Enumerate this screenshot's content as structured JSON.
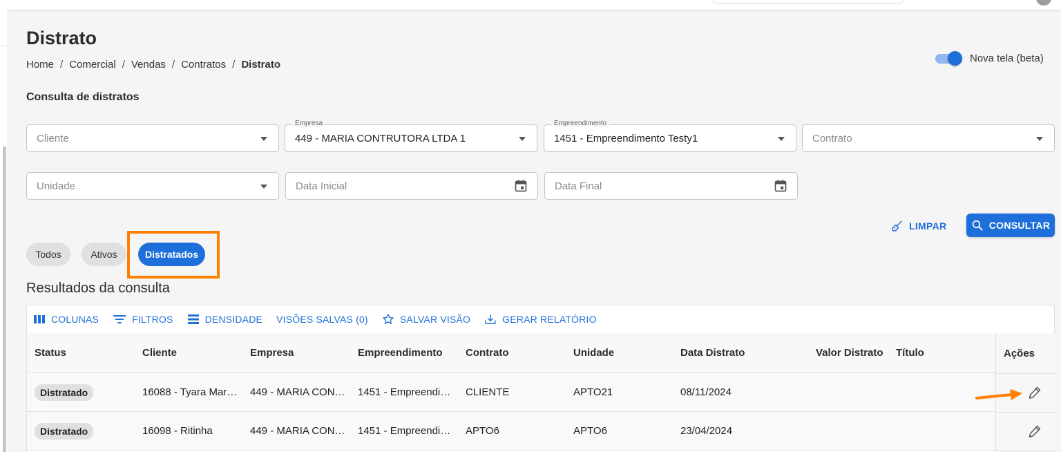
{
  "page": {
    "title": "Distrato",
    "breadcrumb": [
      "Home",
      "Comercial",
      "Vendas",
      "Contratos",
      "Distrato"
    ],
    "beta_toggle_label": "Nova tela (beta)",
    "beta_toggle_on": true,
    "section_title": "Consulta de distratos"
  },
  "filters": {
    "cliente": {
      "placeholder": "Cliente"
    },
    "empresa": {
      "label": "Empresa",
      "value": "449 - MARIA CONTRUTORA LTDA 1"
    },
    "empreendimento": {
      "label": "Empreendimento",
      "value": "1451 - Empreendimento Testy1"
    },
    "contrato": {
      "placeholder": "Contrato"
    },
    "unidade": {
      "placeholder": "Unidade"
    },
    "data_inicial": {
      "placeholder": "Data Inicial"
    },
    "data_final": {
      "placeholder": "Data Final"
    }
  },
  "actions": {
    "limpar": "LIMPAR",
    "consultar": "CONSULTAR"
  },
  "status_chips": [
    "Todos",
    "Ativos",
    "Distratados"
  ],
  "selected_chip": "Distratados",
  "results": {
    "title": "Resultados da consulta",
    "toolbar": {
      "colunas": "COLUNAS",
      "filtros": "FILTROS",
      "densidade": "DENSIDADE",
      "visoes_salvas": "VISÕES SALVAS (0)",
      "salvar_visao": "SALVAR VISÃO",
      "gerar_relatorio": "GERAR RELATÓRIO"
    },
    "columns": [
      "Status",
      "Cliente",
      "Empresa",
      "Empreendimento",
      "Contrato",
      "Unidade",
      "Data Distrato",
      "Valor Distrato",
      "Título",
      "Ações"
    ],
    "rows": [
      {
        "status": "Distratado",
        "cliente": "16088 - Tyara Mar…",
        "empresa": "449 - MARIA CON…",
        "empreendimento": "1451 - Empreendi…",
        "contrato": "CLIENTE",
        "unidade": "APTO21",
        "data_distrato": "08/11/2024",
        "valor_distrato": "",
        "titulo": ""
      },
      {
        "status": "Distratado",
        "cliente": "16098 - Ritinha",
        "empresa": "449 - MARIA CON…",
        "empreendimento": "1451 - Empreendi…",
        "contrato": "APTO6",
        "unidade": "APTO6",
        "data_distrato": "23/04/2024",
        "valor_distrato": "",
        "titulo": ""
      }
    ]
  },
  "colors": {
    "primary": "#1e6fd9",
    "highlight": "#ff7f00",
    "chip_inactive": "#e0e0e0",
    "background": "#f5f5f5"
  }
}
